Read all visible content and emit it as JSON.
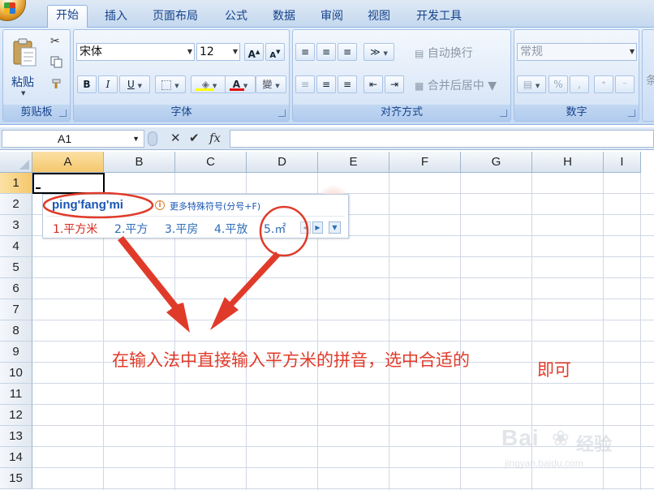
{
  "ribbon": {
    "tabs": [
      {
        "label": "开始",
        "active": true
      },
      {
        "label": "插入"
      },
      {
        "label": "页面布局"
      },
      {
        "label": "公式"
      },
      {
        "label": "数据"
      },
      {
        "label": "审阅"
      },
      {
        "label": "视图"
      },
      {
        "label": "开发工具"
      }
    ],
    "clipboard": {
      "group_label": "剪贴板",
      "paste_label": "粘贴"
    },
    "font": {
      "group_label": "字体",
      "font_name": "宋体",
      "font_size": "12",
      "bold": "B",
      "italic": "I",
      "underline": "U",
      "font_color_glyph": "A",
      "phonetic_glyph": "變"
    },
    "alignment": {
      "group_label": "对齐方式",
      "wrap_text": "自动换行",
      "merge_center": "合并后居中"
    },
    "number": {
      "group_label": "数字",
      "format": "常规",
      "percent": "%",
      "comma": ","
    },
    "cut_off_label": "条"
  },
  "formula_bar": {
    "name_box": "A1",
    "fx": "fx",
    "formula": ""
  },
  "sheet": {
    "columns": [
      "A",
      "B",
      "C",
      "D",
      "E",
      "F",
      "G",
      "H",
      "I"
    ],
    "rows": [
      "1",
      "2",
      "3",
      "4",
      "5",
      "6",
      "7",
      "8",
      "9",
      "10",
      "11",
      "12",
      "13",
      "14",
      "15"
    ],
    "selected_column": "A",
    "selected_row": "1",
    "active_cell": "A1"
  },
  "ime": {
    "input": "ping'fang'mi",
    "hint": "更多特殊符号(分号+F)",
    "info_glyph": "i",
    "candidates": [
      "1.平方米",
      "2.平方",
      "3.平房",
      "4.平放",
      "5.㎡"
    ]
  },
  "annotation": {
    "text_main": "在输入法中直接输入平方米的拼音，选中合适的",
    "text_tail": "即可",
    "color": "#e03b2a"
  },
  "watermark": {
    "brand": "Bai",
    "cn": "经验",
    "url": "jingyan.baidu.com"
  },
  "colors": {
    "ribbon_bg": "#d5e4f7",
    "selection": "#f5c76c",
    "ime_blue": "#1a56b4",
    "ime_red": "#d42a1c"
  }
}
